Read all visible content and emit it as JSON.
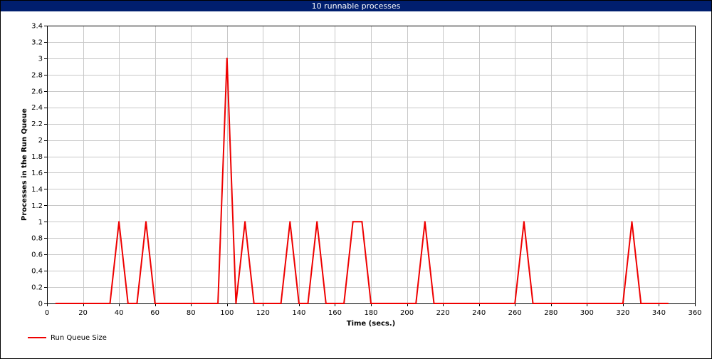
{
  "window": {
    "title": "10 runnable processes"
  },
  "colors": {
    "titlebar": "#001e6e",
    "series": "#ee0000",
    "grid": "#c8c8c8"
  },
  "chart_data": {
    "type": "line",
    "title": "10 runnable processes",
    "xlabel": "Time (secs.)",
    "ylabel": "Processes in the Run Queue",
    "xlim": [
      0,
      360
    ],
    "ylim": [
      0,
      3.4
    ],
    "xticks": [
      0,
      20,
      40,
      60,
      80,
      100,
      120,
      140,
      160,
      180,
      200,
      220,
      240,
      260,
      280,
      300,
      320,
      340,
      360
    ],
    "yticks": [
      0,
      0.2,
      0.4,
      0.6,
      0.8,
      1,
      1.2,
      1.4,
      1.6,
      1.8,
      2,
      2.2,
      2.4,
      2.6,
      2.8,
      3,
      3.2,
      3.4
    ],
    "grid": true,
    "legend_position": "bottom-left",
    "series": [
      {
        "name": "Run Queue Size",
        "x": [
          5,
          35,
          40,
          45,
          50,
          55,
          60,
          95,
          100,
          105,
          110,
          115,
          130,
          135,
          140,
          145,
          150,
          155,
          165,
          170,
          175,
          180,
          205,
          210,
          215,
          260,
          265,
          270,
          320,
          325,
          330,
          345
        ],
        "y": [
          0,
          0,
          1,
          0,
          0,
          1,
          0,
          0,
          3,
          0,
          1,
          0,
          0,
          1,
          0,
          0,
          1,
          0,
          0,
          1,
          1,
          0,
          0,
          1,
          0,
          0,
          1,
          0,
          0,
          1,
          0,
          0
        ]
      }
    ]
  }
}
